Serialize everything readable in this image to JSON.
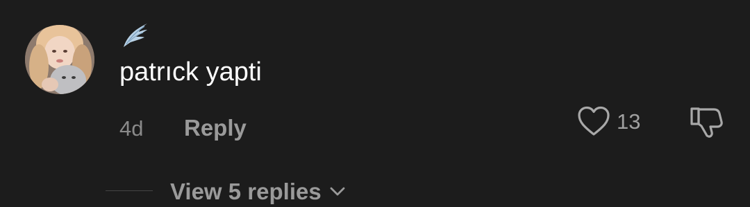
{
  "comment": {
    "text": "patrıck yapti",
    "age": "4d",
    "reply_label": "Reply",
    "like_count": "13",
    "view_replies_label": "View 5 replies"
  },
  "icons": {
    "badge": "wing-icon",
    "like": "heart-icon",
    "dislike": "thumbs-down-icon",
    "expand": "chevron-down-icon"
  },
  "colors": {
    "background": "#1c1c1c",
    "text_primary": "#ffffff",
    "text_secondary": "#9a9a9a"
  }
}
